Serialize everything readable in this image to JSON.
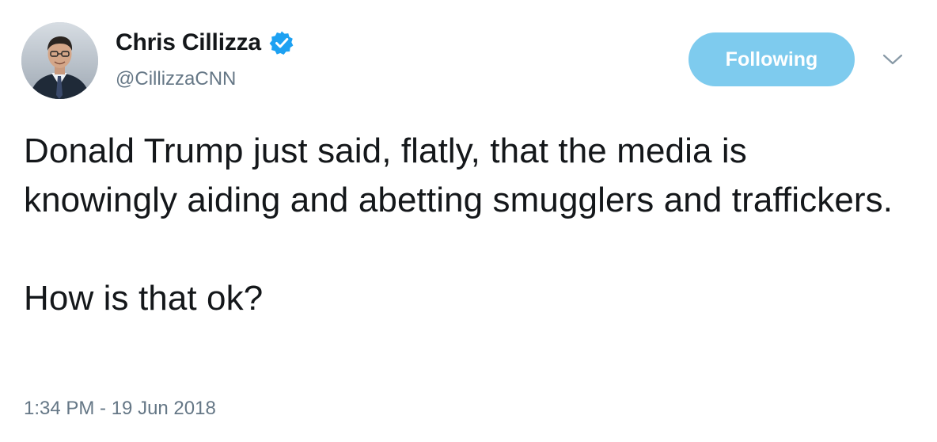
{
  "author": {
    "display_name": "Chris Cillizza",
    "handle": "@CillizzaCNN",
    "verified": true,
    "avatar_icon": "profile-photo"
  },
  "actions": {
    "follow_label": "Following",
    "menu_icon": "chevron-down-icon"
  },
  "tweet": {
    "paragraphs": [
      "Donald Trump just said, flatly, that the media is knowingly aiding and abetting smugglers and traffickers.",
      "How is that ok?"
    ],
    "timestamp": "1:34 PM - 19 Jun 2018"
  },
  "colors": {
    "follow_button_bg": "#7ecbee",
    "verified_blue": "#1da1f2",
    "secondary_text": "#657786",
    "primary_text": "#14171a"
  }
}
